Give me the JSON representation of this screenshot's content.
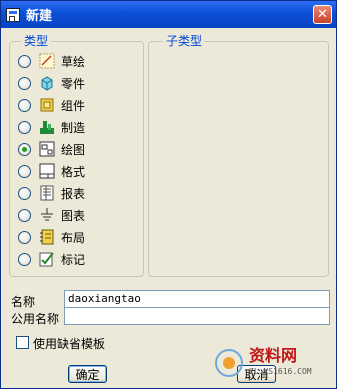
{
  "window": {
    "title": "新建",
    "close_label": "✕"
  },
  "type_group": {
    "label": "类型",
    "selected": "绘图",
    "items": [
      {
        "label": "草绘",
        "icon": "sketch-icon",
        "checked": false
      },
      {
        "label": "零件",
        "icon": "part-icon",
        "checked": false
      },
      {
        "label": "组件",
        "icon": "assembly-icon",
        "checked": false
      },
      {
        "label": "制造",
        "icon": "manufacturing-icon",
        "checked": false
      },
      {
        "label": "绘图",
        "icon": "drawing-icon",
        "checked": true
      },
      {
        "label": "格式",
        "icon": "format-icon",
        "checked": false
      },
      {
        "label": "报表",
        "icon": "report-icon",
        "checked": false
      },
      {
        "label": "图表",
        "icon": "diagram-icon",
        "checked": false
      },
      {
        "label": "布局",
        "icon": "layout-icon",
        "checked": false
      },
      {
        "label": "标记",
        "icon": "markup-icon",
        "checked": false
      }
    ]
  },
  "subtype_group": {
    "label": "子类型"
  },
  "name_field": {
    "label": "名称",
    "value": "daoxiangtao"
  },
  "common_name_field": {
    "label": "公用名称",
    "value": ""
  },
  "default_template": {
    "label": "使用缺省模板",
    "checked": false
  },
  "buttons": {
    "ok": "确定",
    "cancel": "取消"
  },
  "watermark": {
    "title": "资料网",
    "url": "ZL.XS1616.COM"
  },
  "colors": {
    "title_bar": "#0b4fd7",
    "dialog_bg": "#ece9d8",
    "group_label": "#0046d5",
    "radio_selected": "#21a121"
  }
}
